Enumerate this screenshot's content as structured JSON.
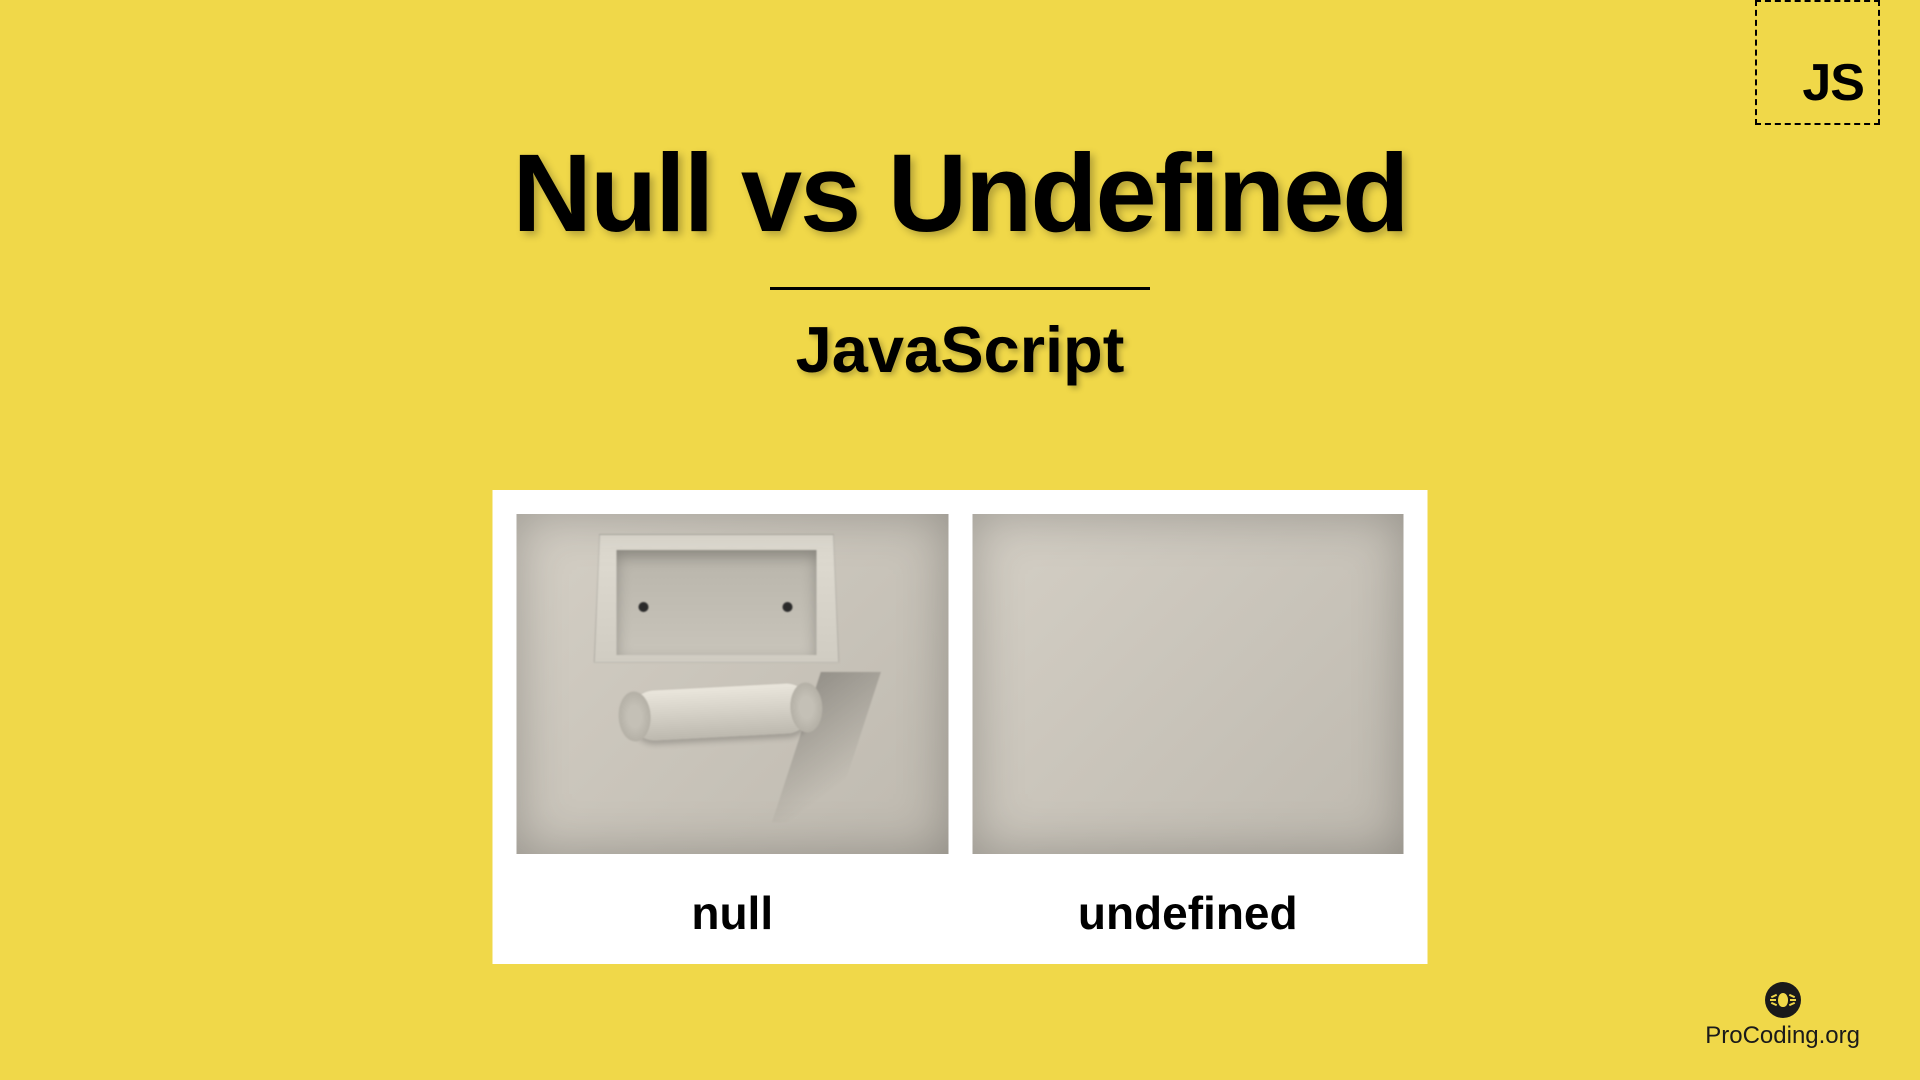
{
  "badge": {
    "label": "JS"
  },
  "header": {
    "title": "Null vs Undefined",
    "subtitle": "JavaScript"
  },
  "panels": {
    "left": {
      "label": "null"
    },
    "right": {
      "label": "undefined"
    }
  },
  "watermark": {
    "text": "ProCoding.org"
  }
}
